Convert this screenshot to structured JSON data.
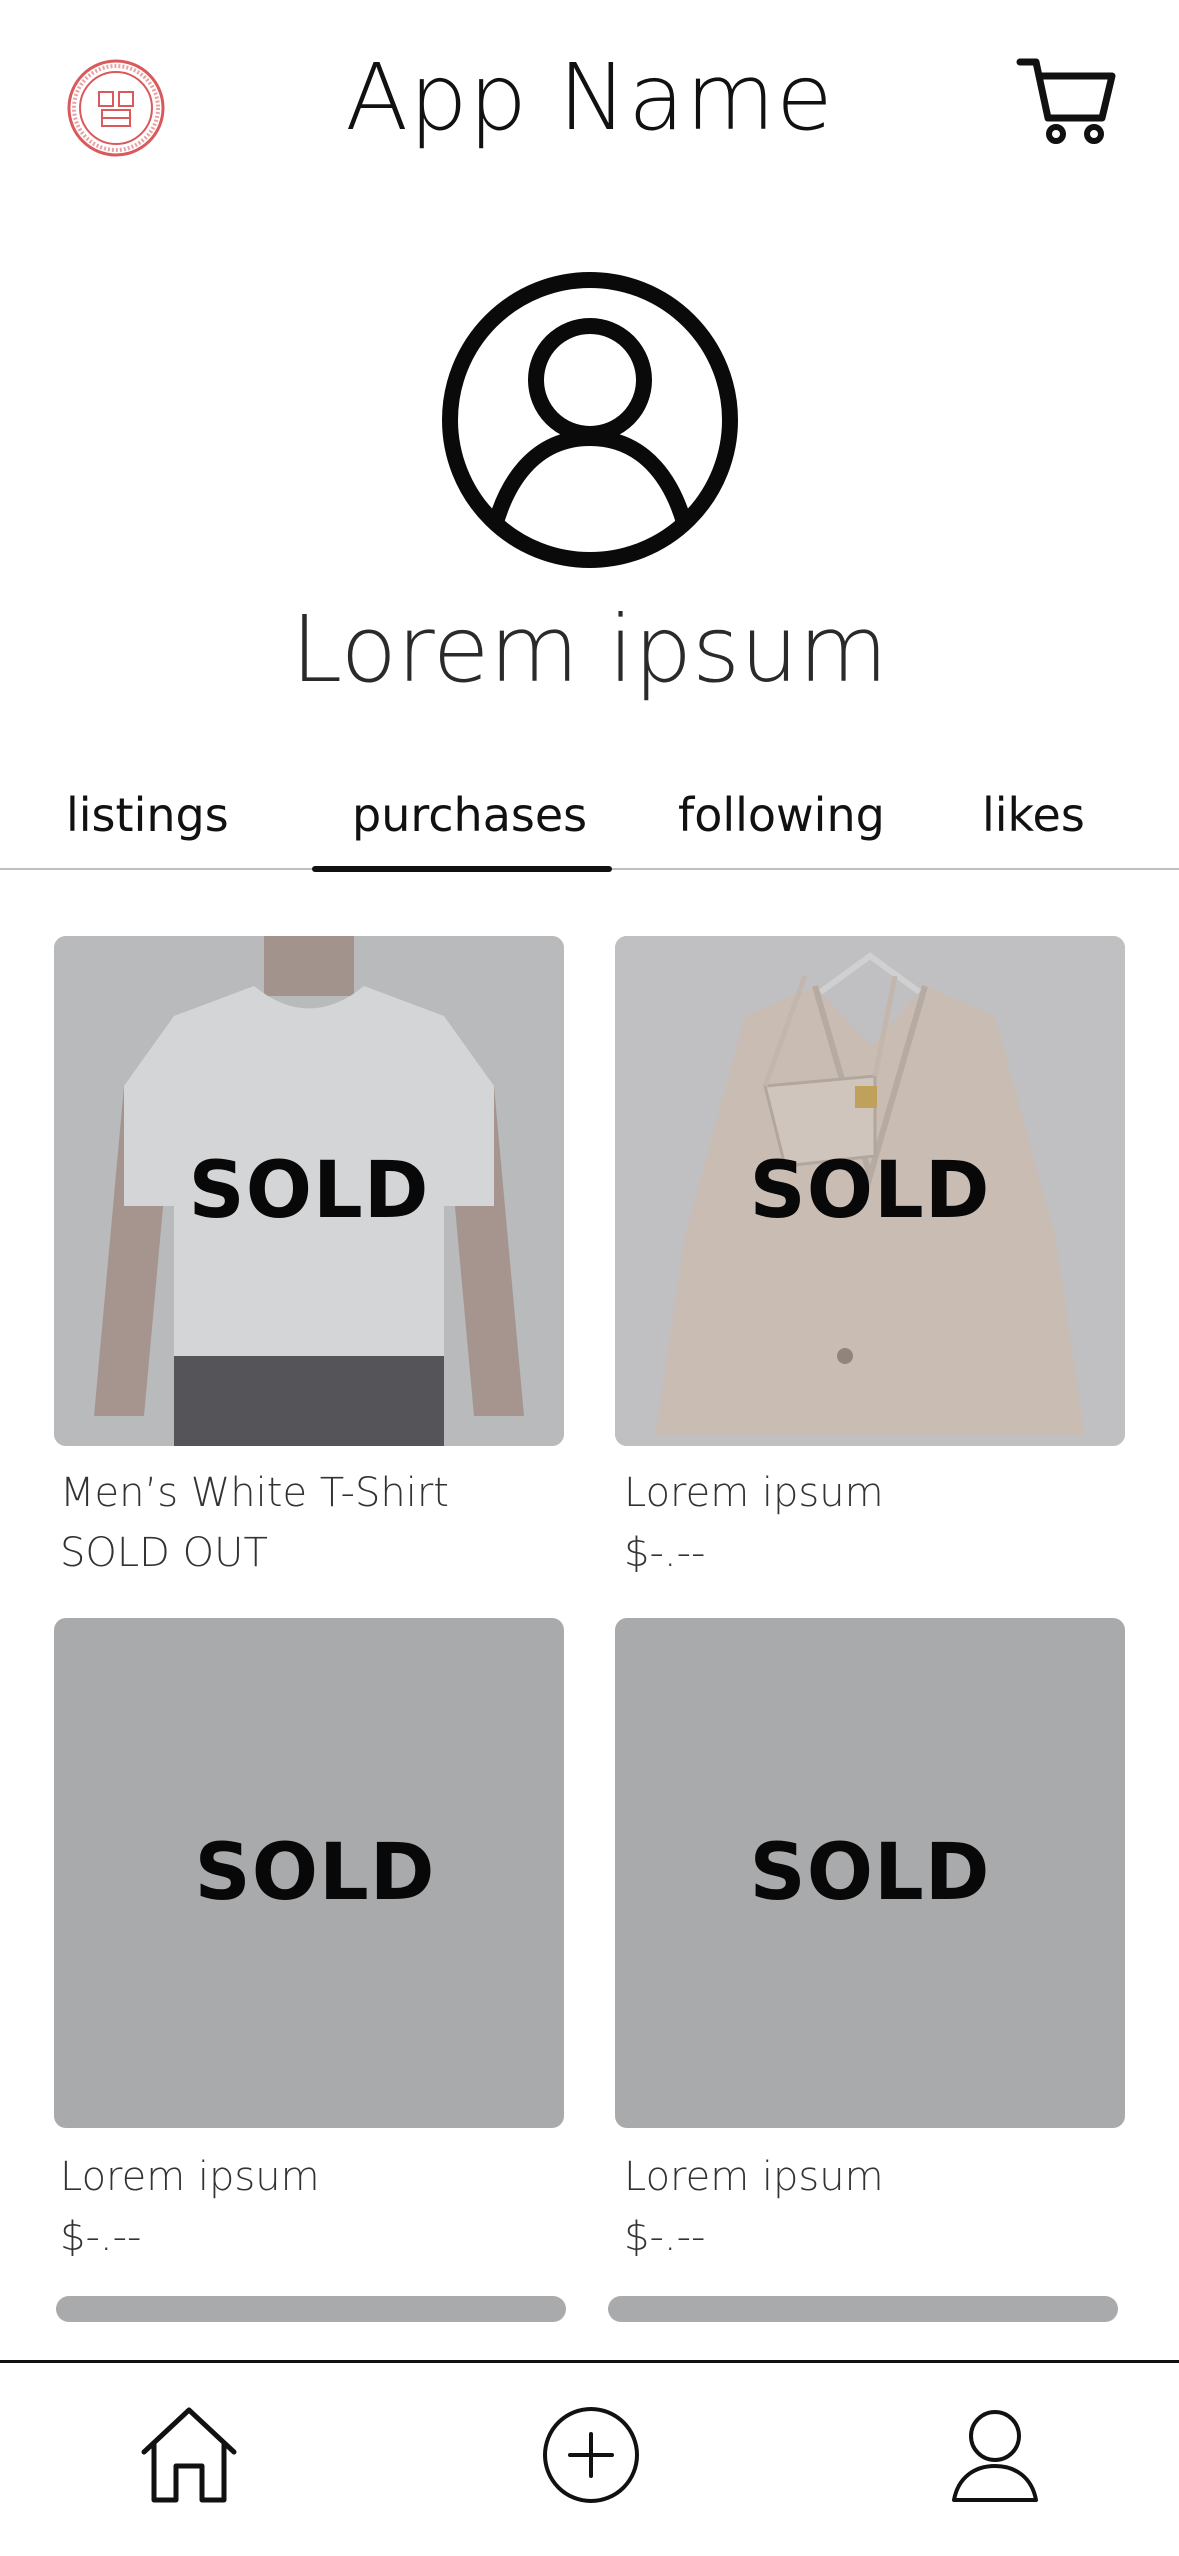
{
  "header": {
    "title": "App Name",
    "logo_icon": "university-seal-icon",
    "cart_icon": "shopping-cart-icon"
  },
  "profile": {
    "avatar_icon": "user-circle-icon",
    "name": "Lorem ipsum"
  },
  "tabs": [
    {
      "label": "listings",
      "active": false
    },
    {
      "label": "purchases",
      "active": true
    },
    {
      "label": "following",
      "active": false
    },
    {
      "label": "likes",
      "active": false
    }
  ],
  "items": [
    {
      "name": "Men’s White T-Shirt",
      "price": "SOLD OUT",
      "overlay": "SOLD",
      "image": "white-t-shirt-photo"
    },
    {
      "name": "Lorem ipsum",
      "price": "$-.--",
      "overlay": "SOLD",
      "image": "blazer-and-bag-photo"
    },
    {
      "name": "Lorem ipsum",
      "price": "$-.--",
      "overlay": "SOLD",
      "image": "placeholder"
    },
    {
      "name": "Lorem ipsum",
      "price": "$-.--",
      "overlay": "SOLD",
      "image": "placeholder"
    }
  ],
  "bottom_nav": {
    "home_icon": "home-icon",
    "add_icon": "add-circle-icon",
    "profile_icon": "user-icon"
  },
  "colors": {
    "logo_red": "#d9595c",
    "placeholder_gray": "#a9aaac",
    "text_dark": "#111111"
  }
}
